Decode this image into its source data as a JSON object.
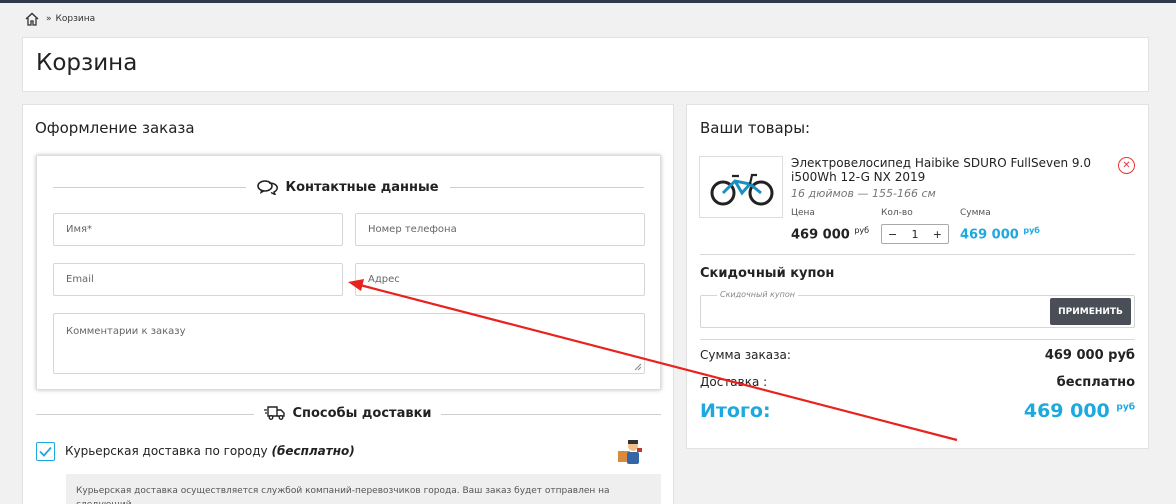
{
  "breadcrumb": {
    "current": "Корзина",
    "separator": "»"
  },
  "page": {
    "title": "Корзина"
  },
  "order_form": {
    "title": "Оформление заказа",
    "contact_heading": "Контактные данные",
    "fields": {
      "name_placeholder": "Имя*",
      "phone_placeholder": "Номер телефона",
      "email_placeholder": "Email",
      "address_placeholder": "Адрес",
      "comment_placeholder": "Комментарии к заказу"
    },
    "delivery_heading": "Способы доставки",
    "courier": {
      "label": "Курьерская доставка по городу",
      "note": "(бесплатно)",
      "checked": true,
      "info": "Курьерская доставка осуществляется службой компаний-перевозчиков города. Ваш заказ будет отправлен на следующий"
    }
  },
  "cart": {
    "title": "Ваши товары:",
    "item": {
      "name": "Электровелосипед Haibike SDURO FullSeven 9.0 i500Wh 12-G NX 2019",
      "size": "16 дюймов — 155-166 см",
      "price_label": "Цена",
      "price": "469 000",
      "qty_label": "Кол-во",
      "qty": "1",
      "qty_minus": "−",
      "qty_plus": "+",
      "sum_label": "Сумма",
      "sum": "469 000",
      "currency": "руб"
    },
    "coupon": {
      "title": "Скидочный купон",
      "placeholder": "Скидочный купон",
      "button": "ПРИМЕНИТЬ"
    },
    "summary": {
      "order_label": "Сумма заказа:",
      "order_value": "469 000 руб",
      "delivery_label": "Доставка :",
      "delivery_value": "бесплатно",
      "total_label": "Итого:",
      "total_value": "469 000",
      "total_currency": "руб"
    }
  },
  "colors": {
    "accent": "#1ea8e0",
    "annotation_arrow": "#e8231f",
    "button_dark": "#4a4f57"
  },
  "icons": [
    "home-icon",
    "chat-bubbles-icon",
    "truck-icon",
    "checkmark-icon",
    "courier-icon",
    "close-icon",
    "bicycle-icon"
  ]
}
